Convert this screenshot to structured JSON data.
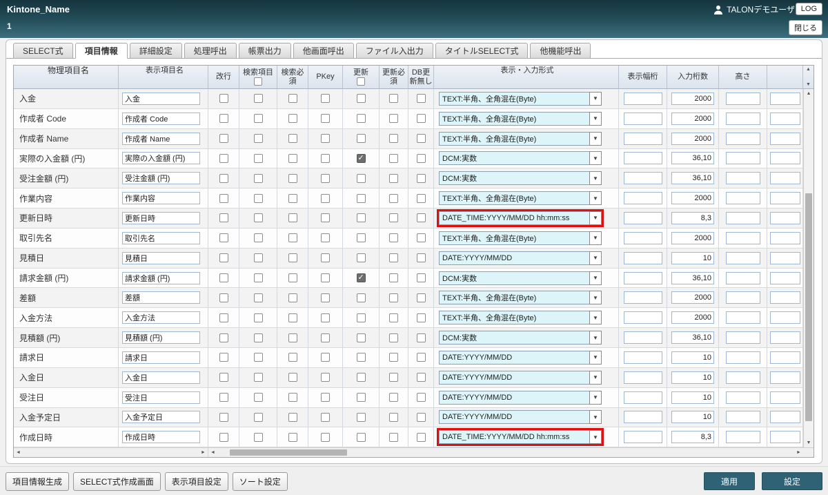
{
  "header": {
    "title": "Kintone_Name",
    "subtitle": "1",
    "user_name": "TALONデモユーザ",
    "log_button": "LOG",
    "close_button": "閉じる"
  },
  "tabs": [
    {
      "label": "SELECT式",
      "active": false
    },
    {
      "label": "項目情報",
      "active": true
    },
    {
      "label": "詳細設定",
      "active": false
    },
    {
      "label": "処理呼出",
      "active": false
    },
    {
      "label": "帳票出力",
      "active": false
    },
    {
      "label": "他画面呼出",
      "active": false
    },
    {
      "label": "ファイル入出力",
      "active": false
    },
    {
      "label": "タイトルSELECT式",
      "active": false
    },
    {
      "label": "他機能呼出",
      "active": false
    }
  ],
  "table": {
    "columns": [
      "物理項目名",
      "表示項目名",
      "改行",
      "検索項目",
      "検索必須",
      "PKey",
      "更新",
      "更新必須",
      "DB更新無し",
      "表示・入力形式",
      "表示幅桁",
      "入力桁数",
      "高さ",
      ""
    ],
    "header_checkbox_columns": [
      3,
      6
    ],
    "check_fields": [
      "kaigyo",
      "search",
      "search_req",
      "pkey",
      "update",
      "update_req",
      "db_no_update"
    ],
    "rows": [
      {
        "physical": "入金",
        "display": "入金",
        "checks": [
          false,
          false,
          false,
          false,
          false,
          false,
          false
        ],
        "format": "TEXT:半角、全角混在(Byte)",
        "width": "",
        "digits": "2000",
        "height": "",
        "extra": "",
        "highlight": false
      },
      {
        "physical": "作成者 Code",
        "display": "作成者 Code",
        "checks": [
          false,
          false,
          false,
          false,
          false,
          false,
          false
        ],
        "format": "TEXT:半角、全角混在(Byte)",
        "width": "",
        "digits": "2000",
        "height": "",
        "extra": "",
        "highlight": false
      },
      {
        "physical": "作成者 Name",
        "display": "作成者 Name",
        "checks": [
          false,
          false,
          false,
          false,
          false,
          false,
          false
        ],
        "format": "TEXT:半角、全角混在(Byte)",
        "width": "",
        "digits": "2000",
        "height": "",
        "extra": "",
        "highlight": false
      },
      {
        "physical": "実際の入金額 (円)",
        "display": "実際の入金額 (円)",
        "checks": [
          false,
          false,
          false,
          false,
          true,
          false,
          false
        ],
        "format": "DCM:実数",
        "width": "",
        "digits": "36,10",
        "height": "",
        "extra": "",
        "highlight": false
      },
      {
        "physical": "受注金額 (円)",
        "display": "受注金額 (円)",
        "checks": [
          false,
          false,
          false,
          false,
          false,
          false,
          false
        ],
        "format": "DCM:実数",
        "width": "",
        "digits": "36,10",
        "height": "",
        "extra": "",
        "highlight": false
      },
      {
        "physical": "作業内容",
        "display": "作業内容",
        "checks": [
          false,
          false,
          false,
          false,
          false,
          false,
          false
        ],
        "format": "TEXT:半角、全角混在(Byte)",
        "width": "",
        "digits": "2000",
        "height": "",
        "extra": "",
        "highlight": false
      },
      {
        "physical": "更新日時",
        "display": "更新日時",
        "checks": [
          false,
          false,
          false,
          false,
          false,
          false,
          false
        ],
        "format": "DATE_TIME:YYYY/MM/DD hh:mm:ss",
        "width": "",
        "digits": "8,3",
        "height": "",
        "extra": "",
        "highlight": true
      },
      {
        "physical": "取引先名",
        "display": "取引先名",
        "checks": [
          false,
          false,
          false,
          false,
          false,
          false,
          false
        ],
        "format": "TEXT:半角、全角混在(Byte)",
        "width": "",
        "digits": "2000",
        "height": "",
        "extra": "",
        "highlight": false
      },
      {
        "physical": "見積日",
        "display": "見積日",
        "checks": [
          false,
          false,
          false,
          false,
          false,
          false,
          false
        ],
        "format": "DATE:YYYY/MM/DD",
        "width": "",
        "digits": "10",
        "height": "",
        "extra": "",
        "highlight": false
      },
      {
        "physical": "請求金額 (円)",
        "display": "請求金額 (円)",
        "checks": [
          false,
          false,
          false,
          false,
          true,
          false,
          false
        ],
        "format": "DCM:実数",
        "width": "",
        "digits": "36,10",
        "height": "",
        "extra": "",
        "highlight": false
      },
      {
        "physical": "差額",
        "display": "差額",
        "checks": [
          false,
          false,
          false,
          false,
          false,
          false,
          false
        ],
        "format": "TEXT:半角、全角混在(Byte)",
        "width": "",
        "digits": "2000",
        "height": "",
        "extra": "",
        "highlight": false
      },
      {
        "physical": "入金方法",
        "display": "入金方法",
        "checks": [
          false,
          false,
          false,
          false,
          false,
          false,
          false
        ],
        "format": "TEXT:半角、全角混在(Byte)",
        "width": "",
        "digits": "2000",
        "height": "",
        "extra": "",
        "highlight": false
      },
      {
        "physical": "見積額 (円)",
        "display": "見積額 (円)",
        "checks": [
          false,
          false,
          false,
          false,
          false,
          false,
          false
        ],
        "format": "DCM:実数",
        "width": "",
        "digits": "36,10",
        "height": "",
        "extra": "",
        "highlight": false
      },
      {
        "physical": "請求日",
        "display": "請求日",
        "checks": [
          false,
          false,
          false,
          false,
          false,
          false,
          false
        ],
        "format": "DATE:YYYY/MM/DD",
        "width": "",
        "digits": "10",
        "height": "",
        "extra": "",
        "highlight": false
      },
      {
        "physical": "入金日",
        "display": "入金日",
        "checks": [
          false,
          false,
          false,
          false,
          false,
          false,
          false
        ],
        "format": "DATE:YYYY/MM/DD",
        "width": "",
        "digits": "10",
        "height": "",
        "extra": "",
        "highlight": false
      },
      {
        "physical": "受注日",
        "display": "受注日",
        "checks": [
          false,
          false,
          false,
          false,
          false,
          false,
          false
        ],
        "format": "DATE:YYYY/MM/DD",
        "width": "",
        "digits": "10",
        "height": "",
        "extra": "",
        "highlight": false
      },
      {
        "physical": "入金予定日",
        "display": "入金予定日",
        "checks": [
          false,
          false,
          false,
          false,
          false,
          false,
          false
        ],
        "format": "DATE:YYYY/MM/DD",
        "width": "",
        "digits": "10",
        "height": "",
        "extra": "",
        "highlight": false
      },
      {
        "physical": "作成日時",
        "display": "作成日時",
        "checks": [
          false,
          false,
          false,
          false,
          false,
          false,
          false
        ],
        "format": "DATE_TIME:YYYY/MM/DD hh:mm:ss",
        "width": "",
        "digits": "8,3",
        "height": "",
        "extra": "",
        "highlight": true
      }
    ]
  },
  "footer": {
    "left_buttons": [
      "項目情報生成",
      "SELECT式作成画面",
      "表示項目設定",
      "ソート設定"
    ],
    "apply_button": "適用",
    "settings_button": "設定"
  },
  "colors": {
    "header_teal_dark": "#15343d",
    "header_teal_light": "#3e6f7d",
    "field_cyan": "#ddf5f8",
    "highlight_red": "#e01010",
    "action_teal": "#2e6274"
  }
}
